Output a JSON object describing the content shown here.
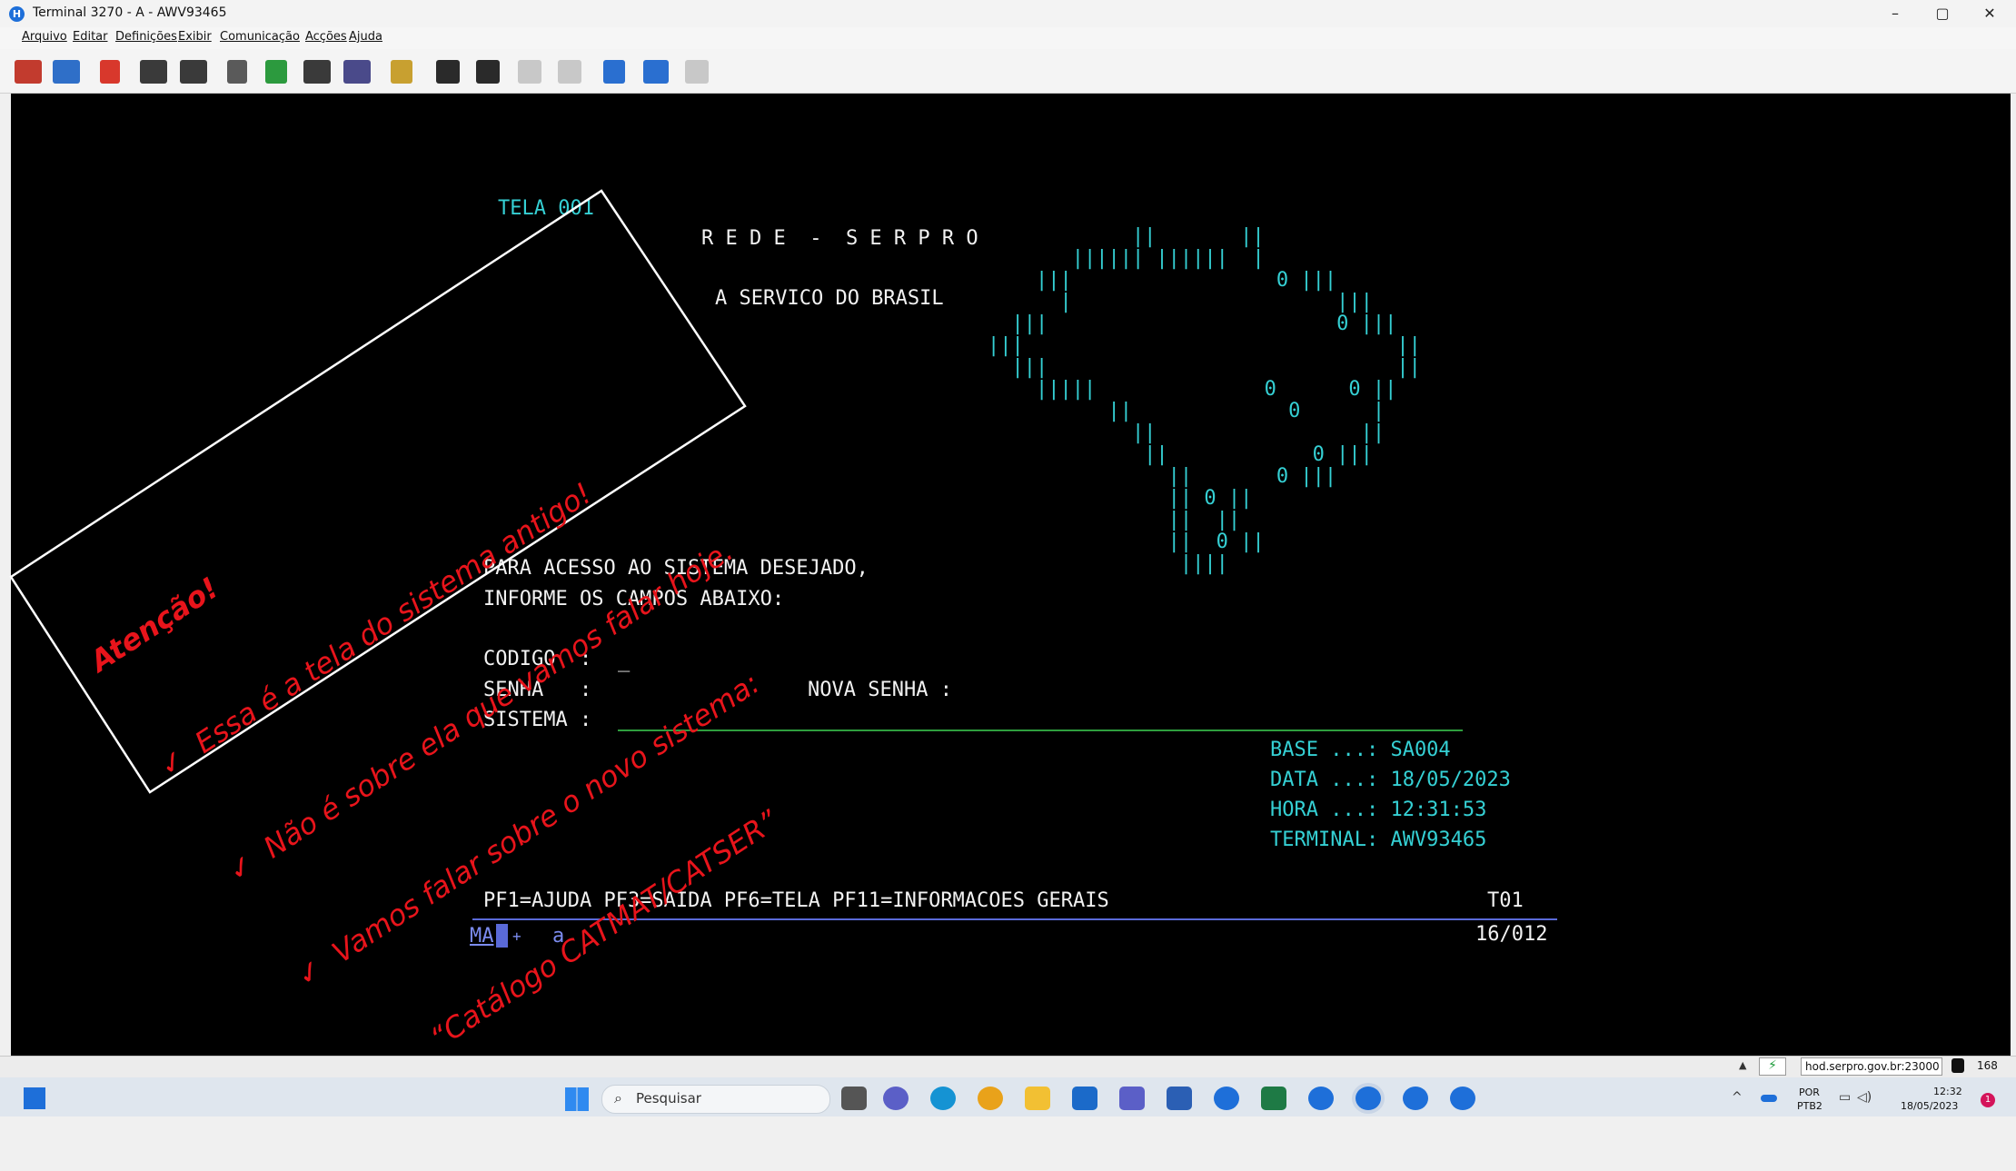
{
  "window": {
    "title": "Terminal 3270 - A - AWV93465",
    "app_icon": "H",
    "controls": {
      "minimize": "–",
      "maximize": "▢",
      "close": "✕"
    }
  },
  "menu": [
    "Arquivo",
    "Editar",
    "Definições",
    "Exibir",
    "Comunicação",
    "Acções",
    "Ajuda"
  ],
  "toolbar_icons": [
    "connect-icon",
    "disconnect-icon",
    "exit-icon",
    "send-icon",
    "receive-icon",
    "copy-icon",
    "paste-icon",
    "print-screen-icon",
    "keyboard-icon",
    "macro-icon",
    "record-macro-icon",
    "play-macro-icon",
    "stop-macro-icon",
    "pause-macro-icon",
    "link-icon",
    "download-icon",
    "expand-icon"
  ],
  "screen": {
    "tela_label": "TELA 001",
    "title": "R E D E  -  S E R P R O",
    "subtitle": "A SERVICO DO BRASIL",
    "instruction_1": "PARA ACESSO AO SISTEMA DESEJADO,",
    "instruction_2": "INFORME OS CAMPOS ABAIXO:",
    "codigo_label": "CODIGO  :",
    "codigo_cursor": "_",
    "senha_label": "SENHA   :",
    "nova_senha_label": "NOVA SENHA :",
    "sistema_label": "SISTEMA :",
    "base": "BASE ...: SA004",
    "data": "DATA ...: 18/05/2023",
    "hora": "HORA ...: 12:31:53",
    "terminal": "TERMINAL: AWV93465",
    "function_keys": "PF1=AJUDA PF3=SAIDA PF6=TELA PF11=INFORMACOES GERAIS",
    "screen_code": "T01",
    "oia_left": "MA",
    "oia_plus": "+",
    "oia_a": "a",
    "cursor_pos": "16/012",
    "map_art": [
      "            ||       ||",
      "       |||||| ||||||  |",
      "    |||                 0 |||",
      "      |                      |||",
      "  |||                        0 |||",
      "|||                               ||",
      "  |||                             ||",
      "    |||||              0      0 ||",
      "          ||             0      |",
      "            ||                 ||",
      "             ||            0 |||",
      "               ||       0 |||",
      "               || 0 ||",
      "               ||  ||",
      "               ||  0 ||",
      "                ||||"
    ]
  },
  "annotation": {
    "title": "Atenção!",
    "line_1": "✓  Essa é a tela do sistema antigo!",
    "line_2": "✓  Não é sobre ela que vamos falar hoje.",
    "line_3": "✓  Vamos falar sobre o novo sistema:",
    "line_4": "“Catálogo CATMAT/CATSER”",
    "color": "#e8141b"
  },
  "statusbar": {
    "host": "hod.serpro.gov.br:23000",
    "count": "168"
  },
  "taskbar": {
    "search_placeholder": "Pesquisar",
    "lang_1": "POR",
    "lang_2": "PTB2",
    "time": "12:32",
    "date": "18/05/2023",
    "notification": "1"
  },
  "colors": {
    "terminal_bg": "#000000",
    "terminal_text": "#f2f2f2",
    "terminal_accent": "#35d0d4",
    "input_line": "#2e9e3e"
  }
}
